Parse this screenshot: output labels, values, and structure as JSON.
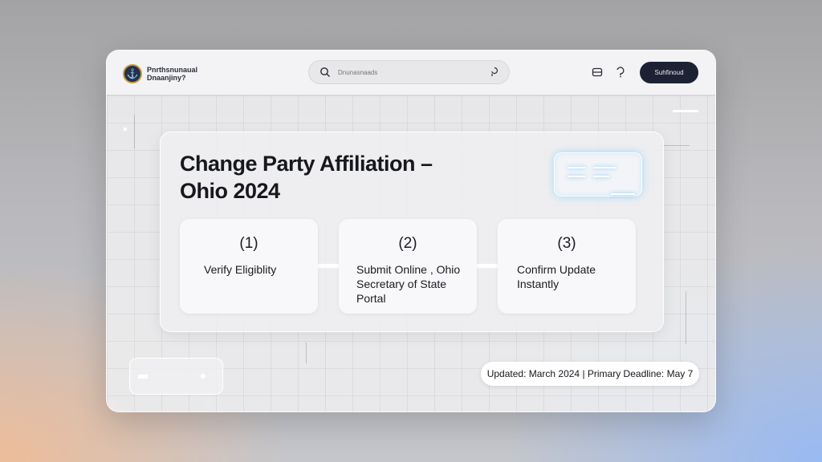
{
  "header": {
    "brand_line1": "Pnrthsnunaual",
    "brand_line2": "Dnaanjiny?",
    "search_placeholder": "Dnunasnaads",
    "account_button": "Suhfinoud"
  },
  "card": {
    "title": "Change Party Affiliation – Ohio 2024",
    "steps": [
      {
        "num": "(1)",
        "label": "Verify Eligiblity"
      },
      {
        "num": "(2)",
        "label": "Submit Online , Ohio Secretary of State Portal"
      },
      {
        "num": "(3)",
        "label": "Confirm Update Instantly"
      }
    ]
  },
  "status": {
    "text": "Updated: March 2024 | Primary Deadline: May 7"
  },
  "icons": {
    "search": "search-icon",
    "mic": "mic-icon",
    "window": "window-icon",
    "help": "help-icon",
    "logo": "seal-logo"
  },
  "colors": {
    "account_button_bg": "#1c2233",
    "glow_accent": "#6ec8ff"
  }
}
